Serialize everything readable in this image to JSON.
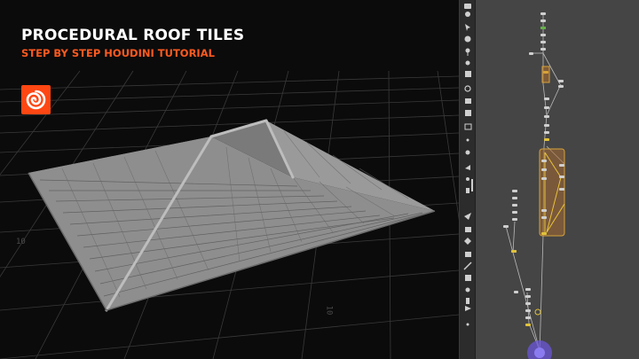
{
  "header": {
    "title": "PROCEDURAL ROOF TILES",
    "subtitle": "STEP BY STEP HOUDINI TUTORIAL"
  },
  "branding": {
    "logo_icon": "houdini-logo-icon",
    "accent": "#ff4713"
  },
  "viewport": {
    "background": "#0b0b0b",
    "grid_color": "#3a3a3a",
    "roof_color": "#8a8a8a",
    "axis_label_left": "10",
    "axis_label_bottom": "10"
  },
  "toolbar": {
    "tools": [
      "lock-icon",
      "light-bulb-icon",
      "select-arrow-icon",
      "sphere-icon",
      "pin-icon",
      "select-icon",
      "transform-icon",
      "rotate-icon",
      "handle-icon",
      "snap-icon",
      "grid-icon",
      "display-icon",
      "ghost-icon",
      "wire-icon",
      "point-icon",
      "brush-icon",
      "paint-icon",
      "measure-icon",
      "camera-icon",
      "render-icon",
      "flipbook-icon",
      "vector-icon",
      "sticky-icon",
      "node-icon",
      "tree-icon",
      "flag-icon",
      "scale-icon",
      "cursor-icon"
    ]
  },
  "network": {
    "background": "#454545",
    "wire_color": "#b9b9b9",
    "node_color": "#cfcfcf",
    "network_box_color": "#b8742e",
    "selected_node_color": "#ffd23f",
    "output_node_color": "#6b55d8"
  }
}
